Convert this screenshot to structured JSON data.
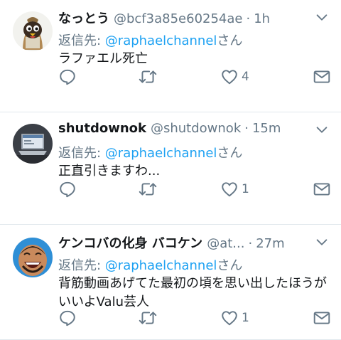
{
  "tweets": [
    {
      "name": "なっとう",
      "handle": "@bcf3a85e60254ae",
      "separator": "·",
      "time": "1h",
      "reply_prefix": "返信先: ",
      "reply_target": "@raphaelchannel",
      "reply_suffix": "さん",
      "text": "ラファエル死亡",
      "like_count": "4",
      "avatar_icon": "penguin-mascot-avatar"
    },
    {
      "name": "shutdownok",
      "handle": "@shutdownok",
      "separator": "·",
      "time": "15m",
      "reply_prefix": "返信先: ",
      "reply_target": "@raphaelchannel",
      "reply_suffix": "さん",
      "text": "正直引きますわ...",
      "like_count": "1",
      "avatar_icon": "laptop-avatar"
    },
    {
      "name": "ケンコバの化身 バコケン",
      "handle": "@at...",
      "separator": "·",
      "time": "27m",
      "reply_prefix": "返信先: ",
      "reply_target": "@raphaelchannel",
      "reply_suffix": "さん",
      "text": "背筋動画あげてた最初の頃を思い出したほうがいいよValu芸人",
      "like_count": "1",
      "avatar_icon": "laughing-man-avatar"
    }
  ],
  "colors": {
    "accent": "#1da1f2",
    "secondary_text": "#657786",
    "divider": "#e1e8ed"
  }
}
